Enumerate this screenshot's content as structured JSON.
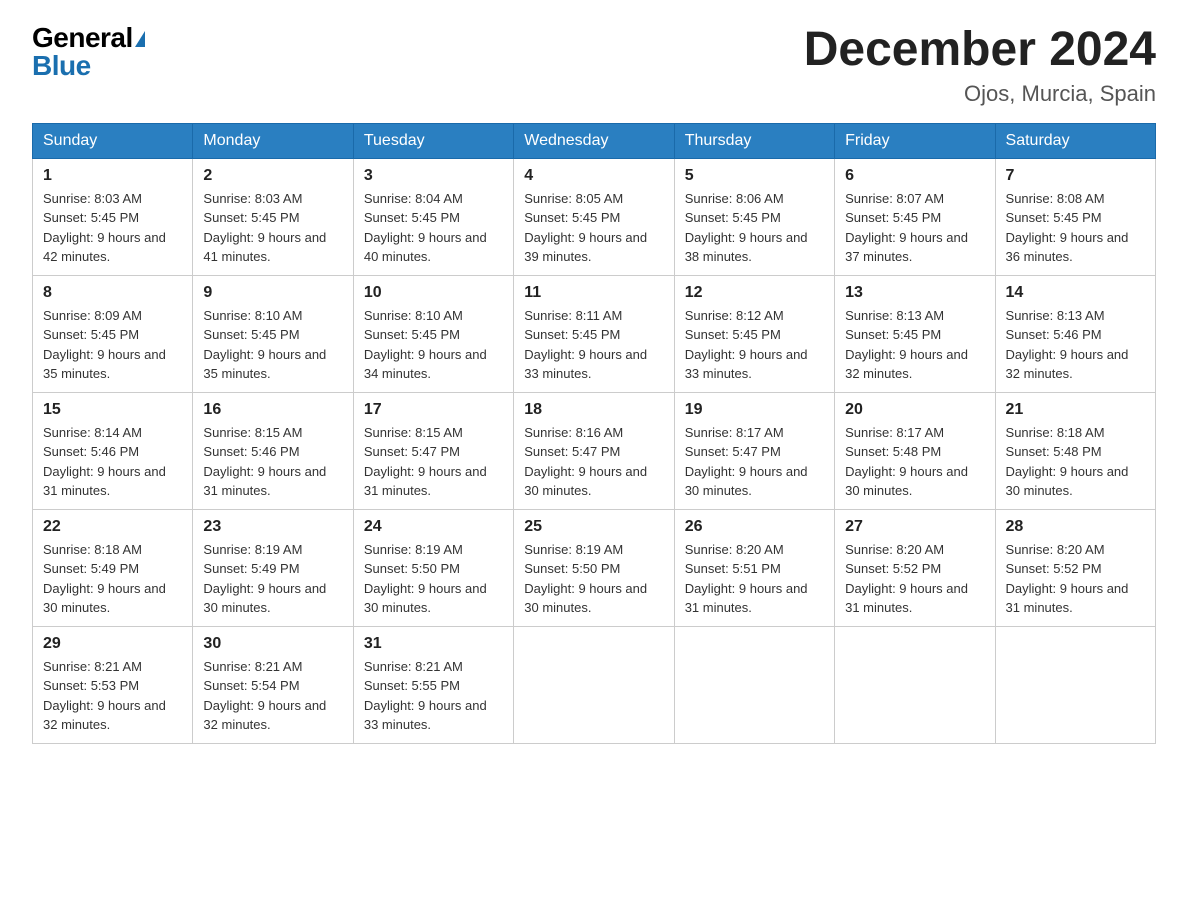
{
  "header": {
    "logo_general": "General",
    "logo_blue": "Blue",
    "title": "December 2024",
    "location": "Ojos, Murcia, Spain"
  },
  "weekdays": [
    "Sunday",
    "Monday",
    "Tuesday",
    "Wednesday",
    "Thursday",
    "Friday",
    "Saturday"
  ],
  "weeks": [
    [
      {
        "day": "1",
        "sunrise": "8:03 AM",
        "sunset": "5:45 PM",
        "daylight": "9 hours and 42 minutes."
      },
      {
        "day": "2",
        "sunrise": "8:03 AM",
        "sunset": "5:45 PM",
        "daylight": "9 hours and 41 minutes."
      },
      {
        "day": "3",
        "sunrise": "8:04 AM",
        "sunset": "5:45 PM",
        "daylight": "9 hours and 40 minutes."
      },
      {
        "day": "4",
        "sunrise": "8:05 AM",
        "sunset": "5:45 PM",
        "daylight": "9 hours and 39 minutes."
      },
      {
        "day": "5",
        "sunrise": "8:06 AM",
        "sunset": "5:45 PM",
        "daylight": "9 hours and 38 minutes."
      },
      {
        "day": "6",
        "sunrise": "8:07 AM",
        "sunset": "5:45 PM",
        "daylight": "9 hours and 37 minutes."
      },
      {
        "day": "7",
        "sunrise": "8:08 AM",
        "sunset": "5:45 PM",
        "daylight": "9 hours and 36 minutes."
      }
    ],
    [
      {
        "day": "8",
        "sunrise": "8:09 AM",
        "sunset": "5:45 PM",
        "daylight": "9 hours and 35 minutes."
      },
      {
        "day": "9",
        "sunrise": "8:10 AM",
        "sunset": "5:45 PM",
        "daylight": "9 hours and 35 minutes."
      },
      {
        "day": "10",
        "sunrise": "8:10 AM",
        "sunset": "5:45 PM",
        "daylight": "9 hours and 34 minutes."
      },
      {
        "day": "11",
        "sunrise": "8:11 AM",
        "sunset": "5:45 PM",
        "daylight": "9 hours and 33 minutes."
      },
      {
        "day": "12",
        "sunrise": "8:12 AM",
        "sunset": "5:45 PM",
        "daylight": "9 hours and 33 minutes."
      },
      {
        "day": "13",
        "sunrise": "8:13 AM",
        "sunset": "5:45 PM",
        "daylight": "9 hours and 32 minutes."
      },
      {
        "day": "14",
        "sunrise": "8:13 AM",
        "sunset": "5:46 PM",
        "daylight": "9 hours and 32 minutes."
      }
    ],
    [
      {
        "day": "15",
        "sunrise": "8:14 AM",
        "sunset": "5:46 PM",
        "daylight": "9 hours and 31 minutes."
      },
      {
        "day": "16",
        "sunrise": "8:15 AM",
        "sunset": "5:46 PM",
        "daylight": "9 hours and 31 minutes."
      },
      {
        "day": "17",
        "sunrise": "8:15 AM",
        "sunset": "5:47 PM",
        "daylight": "9 hours and 31 minutes."
      },
      {
        "day": "18",
        "sunrise": "8:16 AM",
        "sunset": "5:47 PM",
        "daylight": "9 hours and 30 minutes."
      },
      {
        "day": "19",
        "sunrise": "8:17 AM",
        "sunset": "5:47 PM",
        "daylight": "9 hours and 30 minutes."
      },
      {
        "day": "20",
        "sunrise": "8:17 AM",
        "sunset": "5:48 PM",
        "daylight": "9 hours and 30 minutes."
      },
      {
        "day": "21",
        "sunrise": "8:18 AM",
        "sunset": "5:48 PM",
        "daylight": "9 hours and 30 minutes."
      }
    ],
    [
      {
        "day": "22",
        "sunrise": "8:18 AM",
        "sunset": "5:49 PM",
        "daylight": "9 hours and 30 minutes."
      },
      {
        "day": "23",
        "sunrise": "8:19 AM",
        "sunset": "5:49 PM",
        "daylight": "9 hours and 30 minutes."
      },
      {
        "day": "24",
        "sunrise": "8:19 AM",
        "sunset": "5:50 PM",
        "daylight": "9 hours and 30 minutes."
      },
      {
        "day": "25",
        "sunrise": "8:19 AM",
        "sunset": "5:50 PM",
        "daylight": "9 hours and 30 minutes."
      },
      {
        "day": "26",
        "sunrise": "8:20 AM",
        "sunset": "5:51 PM",
        "daylight": "9 hours and 31 minutes."
      },
      {
        "day": "27",
        "sunrise": "8:20 AM",
        "sunset": "5:52 PM",
        "daylight": "9 hours and 31 minutes."
      },
      {
        "day": "28",
        "sunrise": "8:20 AM",
        "sunset": "5:52 PM",
        "daylight": "9 hours and 31 minutes."
      }
    ],
    [
      {
        "day": "29",
        "sunrise": "8:21 AM",
        "sunset": "5:53 PM",
        "daylight": "9 hours and 32 minutes."
      },
      {
        "day": "30",
        "sunrise": "8:21 AM",
        "sunset": "5:54 PM",
        "daylight": "9 hours and 32 minutes."
      },
      {
        "day": "31",
        "sunrise": "8:21 AM",
        "sunset": "5:55 PM",
        "daylight": "9 hours and 33 minutes."
      },
      null,
      null,
      null,
      null
    ]
  ]
}
